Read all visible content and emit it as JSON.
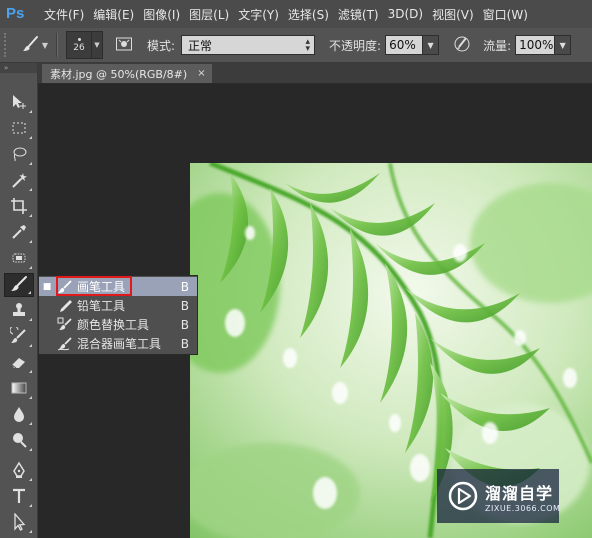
{
  "menubar": {
    "logo": "Ps",
    "items": [
      "文件(F)",
      "编辑(E)",
      "图像(I)",
      "图层(L)",
      "文字(Y)",
      "选择(S)",
      "滤镜(T)",
      "3D(D)",
      "视图(V)",
      "窗口(W)"
    ]
  },
  "options": {
    "brush_size": "26",
    "mode_label": "模式:",
    "mode_value": "正常",
    "opacity_label": "不透明度:",
    "opacity_value": "60%",
    "flow_label": "流量:",
    "flow_value": "100%"
  },
  "document_tab": {
    "title": "素材.jpg @ 50%(RGB/8#)",
    "close": "×"
  },
  "tool_flyout": {
    "items": [
      {
        "label": "画笔工具",
        "shortcut": "B",
        "selected": true,
        "icon": "brush-icon"
      },
      {
        "label": "铅笔工具",
        "shortcut": "B",
        "selected": false,
        "icon": "pencil-icon"
      },
      {
        "label": "颜色替换工具",
        "shortcut": "B",
        "selected": false,
        "icon": "color-replace-icon"
      },
      {
        "label": "混合器画笔工具",
        "shortcut": "B",
        "selected": false,
        "icon": "mixer-brush-icon"
      }
    ]
  },
  "watermark": {
    "title": "溜溜自学",
    "subtitle": "ZIXUE.3066.COM"
  },
  "colors": {
    "menubar_bg": "#4b4b4b",
    "panel_bg": "#535353",
    "canvas_bg": "#282828",
    "flyout_selected": "#9aa2b8",
    "highlight_red": "#e01a1a",
    "ps_blue": "#4aa3f0"
  }
}
